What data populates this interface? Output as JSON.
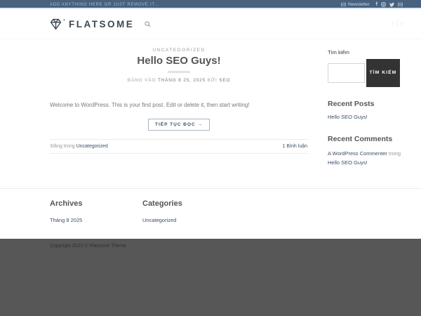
{
  "topbar": {
    "left_text": "ADD ANYTHING HERE OR JUST REMOVE IT...",
    "newsletter_label": "Newsletter",
    "social_icons": [
      "facebook",
      "instagram",
      "twitter",
      "email"
    ]
  },
  "header": {
    "logo_text": "FLATSOME",
    "registered_mark": "®",
    "nav_prev": "‹",
    "nav_next": "›"
  },
  "post": {
    "category": "UNCATEGORIZED",
    "title": "Hello SEO Guys!",
    "meta_prefix": "ĐĂNG VÀO",
    "meta_date": "THÁNG 8 25, 2025",
    "meta_by": "BỞI",
    "meta_author": "SEO",
    "excerpt": "Welcome to WordPress. This is your first post. Edit or delete it, then start writing!",
    "read_more_label": "TIẾP TỤC ĐỌC →",
    "posted_in_label": "Đăng trong",
    "posted_in_category": "Uncategorized",
    "comments_link": "1 Bình luận"
  },
  "sidebar": {
    "search_label": "Tìm kiếm",
    "search_button_label": "TÌM KIẾM",
    "search_value": "",
    "recent_posts_title": "Recent Posts",
    "recent_posts": [
      "Hello SEO Guys!"
    ],
    "recent_comments_title": "Recent Comments",
    "comment_author": "A WordPress Commenter",
    "comment_in_label": "trong",
    "comment_post": "Hello SEO Guys!"
  },
  "footer": {
    "archives_title": "Archives",
    "archives_link": "Tháng 8 2025",
    "categories_title": "Categories",
    "categories_link": "Uncategorized",
    "copyright": "Copyright 2025 © Flatsome Theme"
  },
  "colors": {
    "topbar_bg": "#47617f",
    "link_accent": "#3a4f68",
    "search_button_bg": "#333333",
    "absolute_footer_bg": "#575757"
  }
}
